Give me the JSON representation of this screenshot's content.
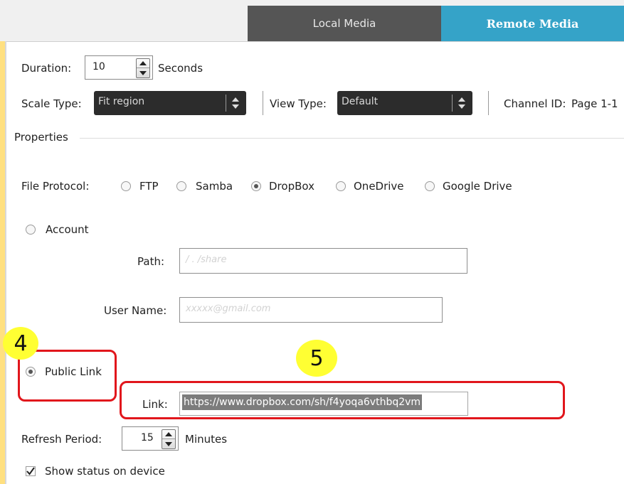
{
  "tabs": {
    "local_label": "Local Media",
    "remote_label": "Remote Media"
  },
  "duration": {
    "label": "Duration:",
    "value": "10",
    "unit": "Seconds"
  },
  "scale_type": {
    "label": "Scale Type:",
    "value": "Fit region"
  },
  "view_type": {
    "label": "View Type:",
    "value": "Default"
  },
  "channel": {
    "label": "Channel ID:",
    "value": "Page 1-1"
  },
  "properties": {
    "title": "Properties"
  },
  "file_protocol": {
    "label": "File Protocol:",
    "options": [
      "FTP",
      "Samba",
      "DropBox",
      "OneDrive",
      "Google Drive"
    ],
    "selected": "DropBox"
  },
  "account": {
    "label": "Account",
    "path_label": "Path:",
    "path_placeholder": "/ . /share",
    "username_label": "User Name:",
    "username_placeholder": "xxxxx@gmail.com"
  },
  "public_link": {
    "label": "Public Link",
    "link_label": "Link:",
    "link_value": "https://www.dropbox.com/sh/f4yoqa6vthbq2vm"
  },
  "callouts": {
    "step4": "4",
    "step5": "5"
  },
  "refresh": {
    "label": "Refresh Period:",
    "value": "15",
    "unit": "Minutes"
  },
  "show_status": {
    "label": "Show status on device",
    "checked": true
  },
  "colors": {
    "remote_tab": "#35a3c8",
    "local_tab": "#555555",
    "callout": "#e1161c",
    "badge": "#ffff33"
  }
}
